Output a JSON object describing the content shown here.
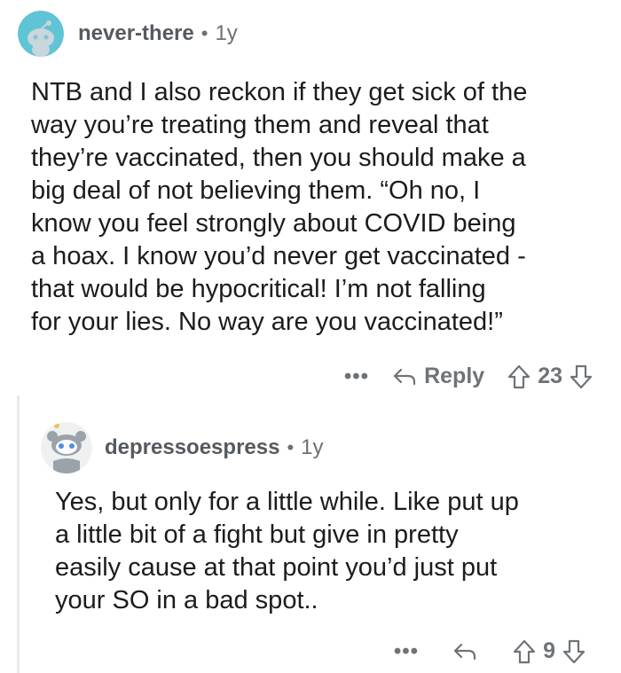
{
  "comments": [
    {
      "username": "never-there",
      "separator": "•",
      "age": "1y",
      "lines": [
        "NTB and I also reckon if they get sick of the",
        "way you’re treating them and reveal that",
        "they’re vaccinated, then you should make a",
        "big deal of not believing them. “Oh no, I",
        "know you feel strongly about COVID being",
        "a hoax. I know you’d never get vaccinated -",
        "that would be hypocritical! I’m not falling",
        "for your lies.  No way are you vaccinated!”"
      ],
      "more_label": "•••",
      "reply_label": "Reply",
      "score": "23",
      "avatar_color": "#5fc4d6"
    },
    {
      "username": "depressoespress",
      "separator": "•",
      "age": "1y",
      "lines": [
        "Yes, but only for a little while. Like put up",
        "a little bit of a fight but give in pretty",
        "easily cause at that point you’d just put",
        "your SO in a bad spot.."
      ],
      "more_label": "•••",
      "score": "9"
    }
  ]
}
